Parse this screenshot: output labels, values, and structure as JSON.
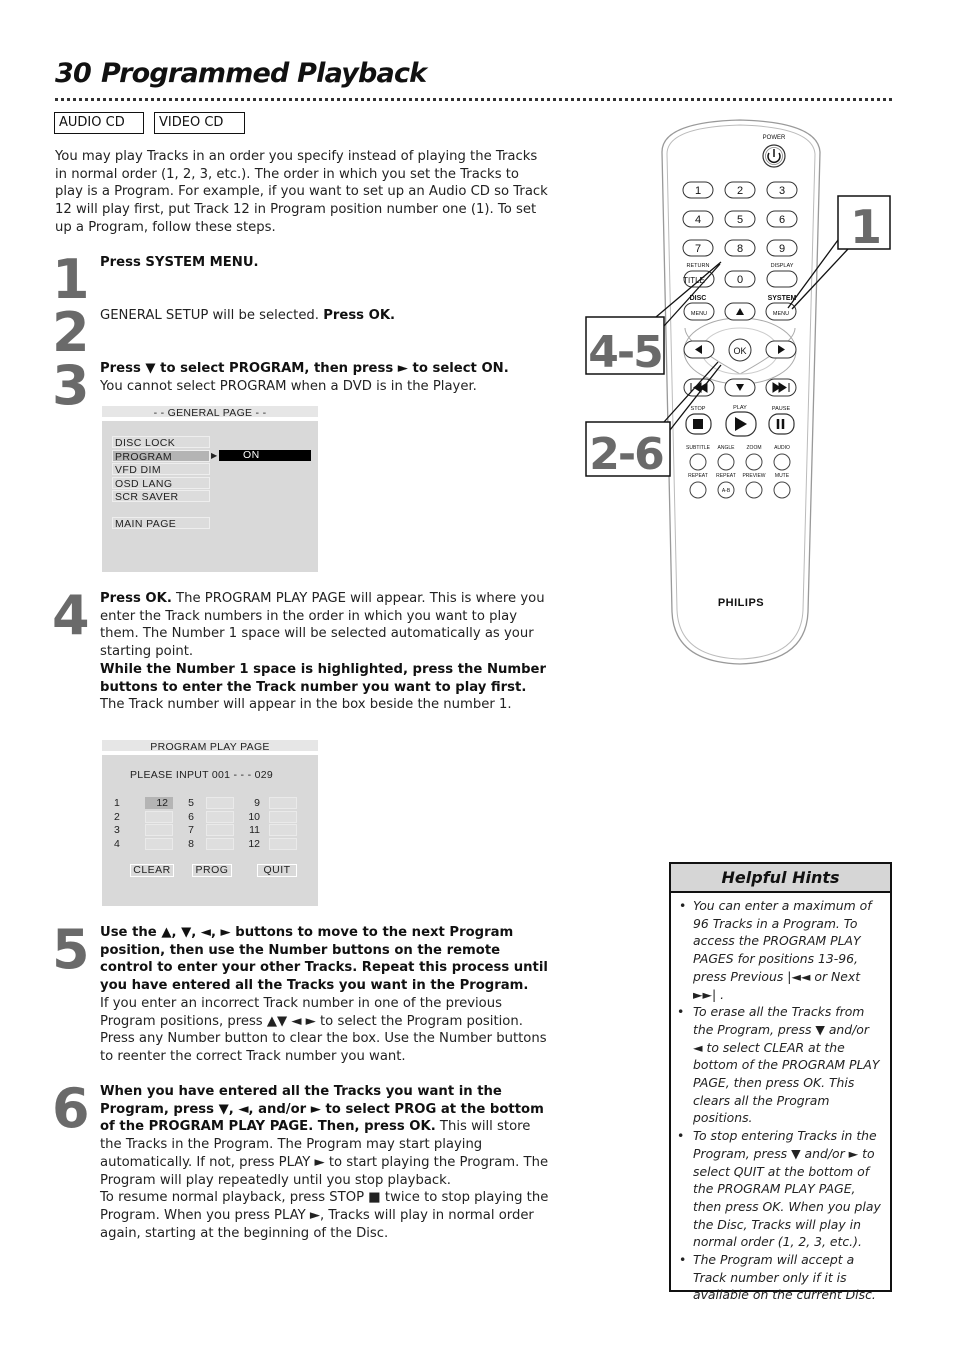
{
  "header": {
    "page_number": "30",
    "title": "Programmed Playback"
  },
  "disc_tags": [
    "AUDIO CD",
    "VIDEO CD"
  ],
  "intro": "You may play Tracks in an order you specify instead of playing the Tracks in normal order (1, 2, 3, etc.). The order in which you set the Tracks to play is a Program. For example, if you want to set up an Audio CD so Track 12 will play first, put Track 12 in Program position number one (1). To set up a Program, follow these steps.",
  "steps": [
    {
      "number": "1",
      "bold": "Press SYSTEM MENU.",
      "text": ""
    },
    {
      "number": "2",
      "pre": "GENERAL SETUP will be selected. ",
      "bold": "Press OK.",
      "text": ""
    },
    {
      "number": "3",
      "bold": "Press ▼ to select PROGRAM, then press ► to select ON.",
      "text": "You cannot select PROGRAM when a DVD is in the Player."
    },
    {
      "number": "4",
      "bold": "Press OK.",
      "text": " The PROGRAM PLAY PAGE will appear. This is where you enter the Track numbers in the order in which you want to play them. The Number 1 space will be selected automatically as your starting point.",
      "bold2": "While the Number 1 space is highlighted, press the Number buttons to enter the Track number you want to play first.",
      "text2": " The Track number will appear in the box beside the number 1."
    },
    {
      "number": "5",
      "bold": "Use the ▲, ▼, ◄, ► buttons to move to the next Program position, then use the Number buttons on the remote control to enter your other Tracks. Repeat this process until you have entered all the Tracks you want in the Program.",
      "text": "If you enter an incorrect Track number in one of the previous Program positions, press ▲▼ ◄ ► to select the Program position. Press any Number button to clear the box. Use the Number buttons to reenter the correct Track number you want."
    },
    {
      "number": "6",
      "bold": "When you have entered all the Tracks you want in the Program, press ▼, ◄, and/or ► to select PROG at the bottom of the PROGRAM PLAY PAGE. Then, press OK.",
      "text": " This will store the Tracks in the Program. The Program may start playing automatically. If not, press PLAY ► to start playing the Program. The Program will play repeatedly until you stop playback.",
      "text2": "To resume normal playback, press STOP ■ twice to stop playing the Program. When you press PLAY ►, Tracks will play in normal order again, starting at the beginning of the Disc."
    }
  ],
  "general_page": {
    "title": "- -  GENERAL PAGE  - -",
    "items": [
      "DISC LOCK",
      "PROGRAM",
      "VFD DIM",
      "OSD LANG",
      "SCR SAVER",
      "MAIN PAGE"
    ],
    "selected_item": "PROGRAM",
    "selected_value": "ON"
  },
  "program_play_page": {
    "title": "PROGRAM PLAY PAGE",
    "prompt": "PLEASE INPUT 001 - - - 029",
    "slots": [
      {
        "n": "1",
        "value": "12"
      },
      {
        "n": "2",
        "value": ""
      },
      {
        "n": "3",
        "value": ""
      },
      {
        "n": "4",
        "value": ""
      },
      {
        "n": "5",
        "value": ""
      },
      {
        "n": "6",
        "value": ""
      },
      {
        "n": "7",
        "value": ""
      },
      {
        "n": "8",
        "value": ""
      },
      {
        "n": "9",
        "value": ""
      },
      {
        "n": "10",
        "value": ""
      },
      {
        "n": "11",
        "value": ""
      },
      {
        "n": "12",
        "value": ""
      }
    ],
    "buttons": [
      "CLEAR",
      "PROG",
      "QUIT"
    ]
  },
  "remote": {
    "brand": "PHILIPS",
    "labels": {
      "power": "POWER",
      "return": "RETURN",
      "display": "DISPLAY",
      "title": "TITLE",
      "disc": "DISC",
      "system": "SYSTEM",
      "menu": "MENU",
      "ok": "OK",
      "stop": "STOP",
      "play": "PLAY",
      "pause": "PAUSE",
      "subtitle": "SUBTITLE",
      "angle": "ANGLE",
      "zoom": "ZOOM",
      "audio": "AUDIO",
      "repeat": "REPEAT",
      "repeat_ab": "REPEAT",
      "ab": "A-B",
      "preview": "PREVIEW",
      "mute": "MUTE"
    },
    "digits": [
      "1",
      "2",
      "3",
      "4",
      "5",
      "6",
      "7",
      "8",
      "9",
      "0"
    ],
    "callouts": [
      "1",
      "4-5",
      "2-6"
    ]
  },
  "hints": {
    "title": "Helpful Hints",
    "items": [
      "You can enter a maximum of 96 Tracks in a Program. To access the PROGRAM PLAY PAGES for positions 13-96, press Previous |◄◄ or Next ►►| .",
      "To erase all the Tracks from the Program, press ▼ and/or ◄ to select CLEAR at the bottom of the PROGRAM PLAY PAGE, then press OK. This clears all the Program positions.",
      "To stop entering Tracks in the Program, press ▼ and/or ► to select QUIT at the bottom of the PROGRAM PLAY PAGE, then press OK. When you play the Disc, Tracks will play in normal order (1, 2, 3, etc.).",
      "The Program will accept a Track number only if it is available on the current Disc."
    ]
  },
  "colors": {
    "step_number_gray": "#6a6a6a",
    "osd_background": "#d9d9d9",
    "osd_selected": "#b4b4b4",
    "hints_header": "#d6d6d6"
  }
}
